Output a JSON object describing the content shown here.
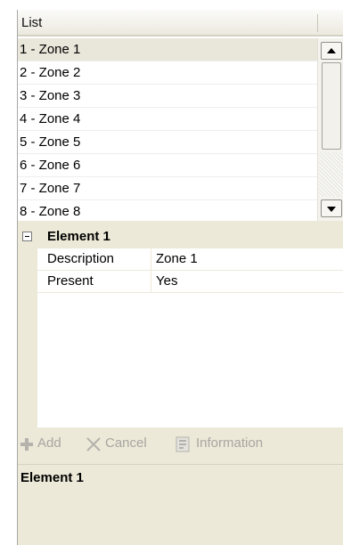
{
  "list": {
    "header": "List",
    "items": [
      {
        "label": "1 - Zone 1"
      },
      {
        "label": "2 - Zone 2"
      },
      {
        "label": "3 - Zone 3"
      },
      {
        "label": "4 - Zone 4"
      },
      {
        "label": "5 - Zone 5"
      },
      {
        "label": "6 - Zone 6"
      },
      {
        "label": "7 - Zone 7"
      },
      {
        "label": "8 - Zone 8"
      }
    ],
    "selected_index": 0
  },
  "properties": {
    "category": "Element 1",
    "rows": [
      {
        "name": "Description",
        "value": "Zone 1"
      },
      {
        "name": "Present",
        "value": "Yes"
      }
    ]
  },
  "toolbar": {
    "add_label": "Add",
    "cancel_label": "Cancel",
    "info_label": "Information",
    "icons": {
      "add": "plus-icon",
      "cancel": "x-icon",
      "info": "information-icon"
    }
  },
  "description_pane": {
    "title": "Element 1"
  },
  "colors": {
    "panel_bg": "#ece9d8",
    "selected_row": "#e9e6da",
    "disabled_text": "#a7a6a1"
  }
}
